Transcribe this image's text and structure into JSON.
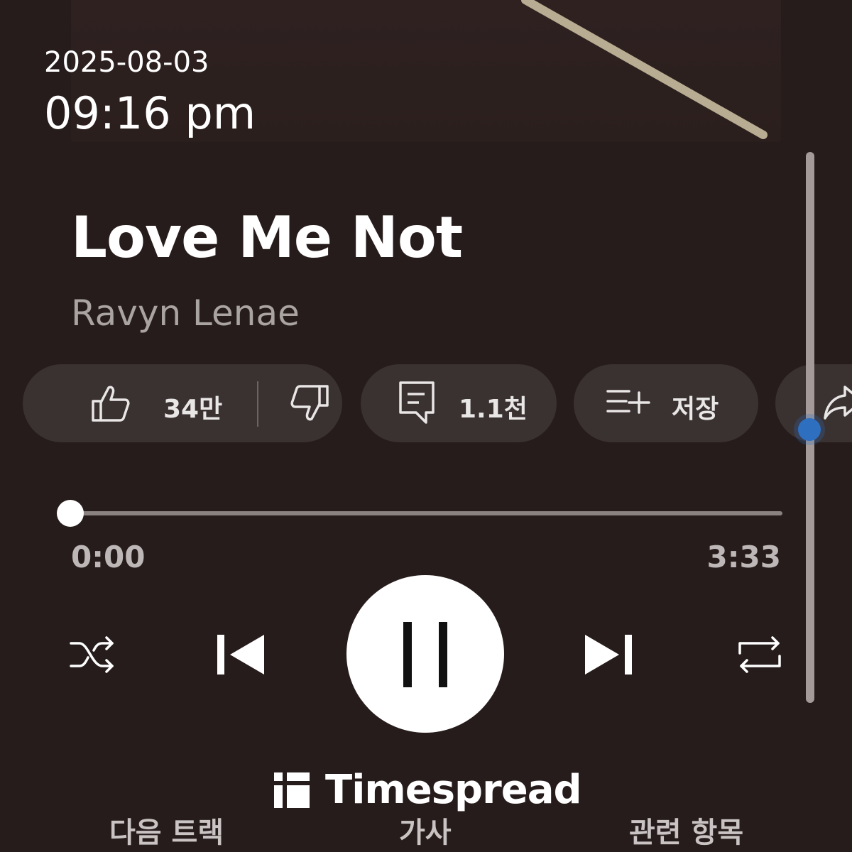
{
  "timestamp": {
    "date": "2025-08-03",
    "time": "09:16 pm"
  },
  "track": {
    "title": "Love Me Not",
    "artist": "Ravyn Lenae"
  },
  "actions": {
    "likes": "34만",
    "comments": "1.1천",
    "save_label": "저장"
  },
  "playback": {
    "current_time": "0:00",
    "total_time": "3:33",
    "progress": 0,
    "state": "playing"
  },
  "watermark": {
    "name": "Timespread"
  },
  "tabs": [
    {
      "label": "다음 트랙"
    },
    {
      "label": "가사"
    },
    {
      "label": "관련 항목"
    }
  ],
  "colors": {
    "background": "#271c1c",
    "accent_dot": "#2f6fc0",
    "pill": "#3a3131"
  },
  "icons": [
    "thumbs-up-icon",
    "thumbs-down-icon",
    "comment-icon",
    "add-to-playlist-icon",
    "share-icon",
    "shuffle-icon",
    "previous-icon",
    "pause-icon",
    "next-icon",
    "repeat-icon"
  ]
}
